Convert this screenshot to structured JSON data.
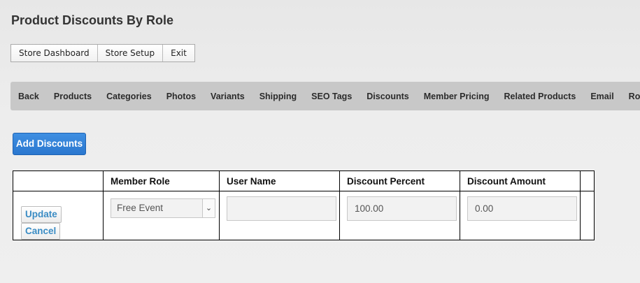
{
  "page": {
    "title": "Product Discounts By Role"
  },
  "toolbar": {
    "buttons": [
      "Store Dashboard",
      "Store Setup",
      "Exit"
    ]
  },
  "nav": {
    "items": [
      "Back",
      "Products",
      "Categories",
      "Photos",
      "Variants",
      "Shipping",
      "SEO Tags",
      "Discounts",
      "Member Pricing",
      "Related Products",
      "Email",
      "Roles"
    ]
  },
  "actions": {
    "add_label": "Add Discounts"
  },
  "grid": {
    "headers": [
      "",
      "Member Role",
      "User Name",
      "Discount Percent",
      "Discount Amount",
      ""
    ],
    "row": {
      "update_label": "Update",
      "cancel_label": "Cancel",
      "member_role": "Free Event",
      "user_name": "",
      "discount_percent": "100.00",
      "discount_amount": "0.00"
    }
  },
  "icons": {
    "select_arrow": "chevron-down-icon"
  }
}
